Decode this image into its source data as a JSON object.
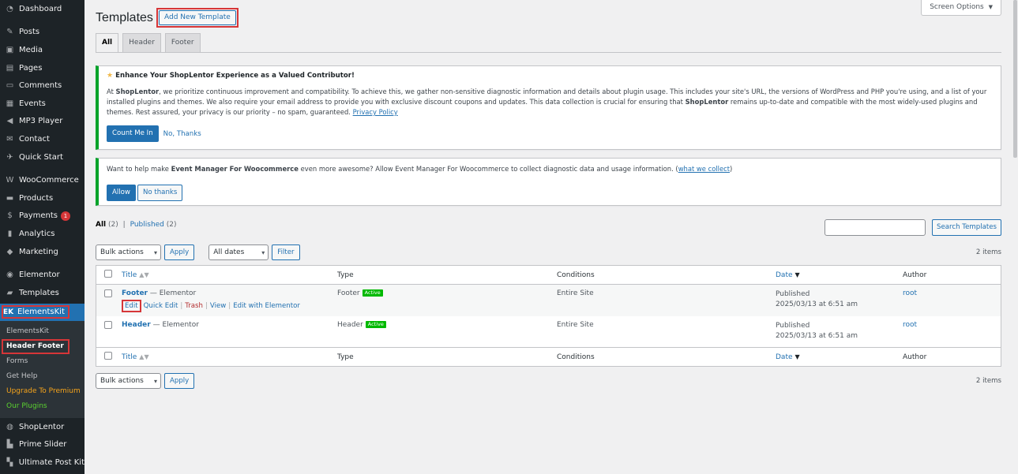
{
  "sidebar": {
    "items": [
      {
        "label": "Dashboard",
        "icon": "dashboard-icon",
        "glyph": "◔"
      },
      {
        "sep": true
      },
      {
        "label": "Posts",
        "icon": "pin-icon",
        "glyph": "✎"
      },
      {
        "label": "Media",
        "icon": "media-icon",
        "glyph": "▣"
      },
      {
        "label": "Pages",
        "icon": "pages-icon",
        "glyph": "▤"
      },
      {
        "label": "Comments",
        "icon": "comments-icon",
        "glyph": "▭"
      },
      {
        "label": "Events",
        "icon": "calendar-icon",
        "glyph": "▦"
      },
      {
        "label": "MP3 Player",
        "icon": "mp3-icon",
        "glyph": "◀"
      },
      {
        "label": "Contact",
        "icon": "mail-icon",
        "glyph": "✉"
      },
      {
        "label": "Quick Start",
        "icon": "quick-start-icon",
        "glyph": "✈"
      },
      {
        "sep": true
      },
      {
        "label": "WooCommerce",
        "icon": "woocommerce-icon",
        "glyph": "W"
      },
      {
        "label": "Products",
        "icon": "products-icon",
        "glyph": "▬"
      },
      {
        "label": "Payments",
        "icon": "payments-icon",
        "glyph": "$",
        "badge": "1"
      },
      {
        "label": "Analytics",
        "icon": "analytics-icon",
        "glyph": "▮"
      },
      {
        "label": "Marketing",
        "icon": "marketing-icon",
        "glyph": "◆"
      },
      {
        "sep": true
      },
      {
        "label": "Elementor",
        "icon": "elementor-icon",
        "glyph": "◉"
      },
      {
        "label": "Templates",
        "icon": "folder-icon",
        "glyph": "▰"
      }
    ],
    "current": {
      "label": "ElementsKit",
      "icon": "elementskit-icon",
      "glyph": "EK"
    },
    "submenu": [
      {
        "label": "ElementsKit",
        "cls": ""
      },
      {
        "label": "Header Footer",
        "cls": "active"
      },
      {
        "label": "Forms",
        "cls": ""
      },
      {
        "label": "Get Help",
        "cls": ""
      },
      {
        "label": "Upgrade To Premium",
        "cls": "upgrade"
      },
      {
        "label": "Our Plugins",
        "cls": "plugins"
      }
    ],
    "after": [
      {
        "label": "ShopLentor",
        "icon": "shoplentor-icon",
        "glyph": "◍"
      },
      {
        "label": "Prime Slider",
        "icon": "prime-slider-icon",
        "glyph": "▙"
      },
      {
        "label": "Ultimate Post Kit",
        "icon": "post-kit-icon",
        "glyph": "▚"
      }
    ]
  },
  "header": {
    "title": "Templates",
    "add_new": "Add New Template",
    "screen_options": "Screen Options"
  },
  "tabs": [
    "All",
    "Header",
    "Footer"
  ],
  "notice1": {
    "title": "Enhance Your ShopLentor Experience as a Valued Contributor!",
    "body_pre": "At ",
    "brand": "ShopLentor",
    "body_mid": ", we prioritize continuous improvement and compatibility. To achieve this, we gather non-sensitive diagnostic information and details about plugin usage. This includes your site's URL, the versions of WordPress and PHP you're using, and a list of your installed plugins and themes. We also require your email address to provide you with exclusive discount coupons and updates. This data collection is crucial for ensuring that ",
    "brand2": "ShopLentor",
    "body_post": " remains up-to-date and compatible with the most widely-used plugins and themes. Rest assured, your privacy is our priority – no spam, guaranteed. ",
    "privacy_link": "Privacy Policy",
    "btn_yes": "Count Me In",
    "btn_no": "No, Thanks"
  },
  "notice2": {
    "text_pre": "Want to help make ",
    "brand": "Event Manager For Woocommerce",
    "text_post": " even more awesome? Allow Event Manager For Woocommerce to collect diagnostic data and usage information. (",
    "link": "what we collect",
    "text_end": ")",
    "btn_allow": "Allow",
    "btn_no": "No thanks"
  },
  "filters": {
    "all": "All",
    "all_count": "(2)",
    "sep": "|",
    "published": "Published",
    "published_count": "(2)"
  },
  "search": {
    "button": "Search Templates",
    "value": ""
  },
  "tablenav": {
    "bulk": "Bulk actions",
    "apply": "Apply",
    "dates": "All dates",
    "filter": "Filter",
    "items": "2 items"
  },
  "table": {
    "columns": {
      "title": "Title",
      "type": "Type",
      "conditions": "Conditions",
      "date": "Date",
      "author": "Author"
    },
    "rows": [
      {
        "title": "Footer",
        "suffix": "— Elementor",
        "type": "Footer",
        "badge": "Active",
        "conditions": "Entire Site",
        "status": "Published",
        "date": "2025/03/13 at 6:51 am",
        "author": "root",
        "actions": {
          "edit": "Edit",
          "quick_edit": "Quick Edit",
          "trash": "Trash",
          "view": "View",
          "edit_el": "Edit with Elementor",
          "sep": "|"
        }
      },
      {
        "title": "Header",
        "suffix": "— Elementor",
        "type": "Header",
        "badge": "Active",
        "conditions": "Entire Site",
        "status": "Published",
        "date": "2025/03/13 at 6:51 am",
        "author": "root"
      }
    ]
  },
  "colors": {
    "accent": "#2271b1",
    "sidebar": "#1d2327",
    "highlight": "#d63638",
    "success": "#00a32a"
  }
}
